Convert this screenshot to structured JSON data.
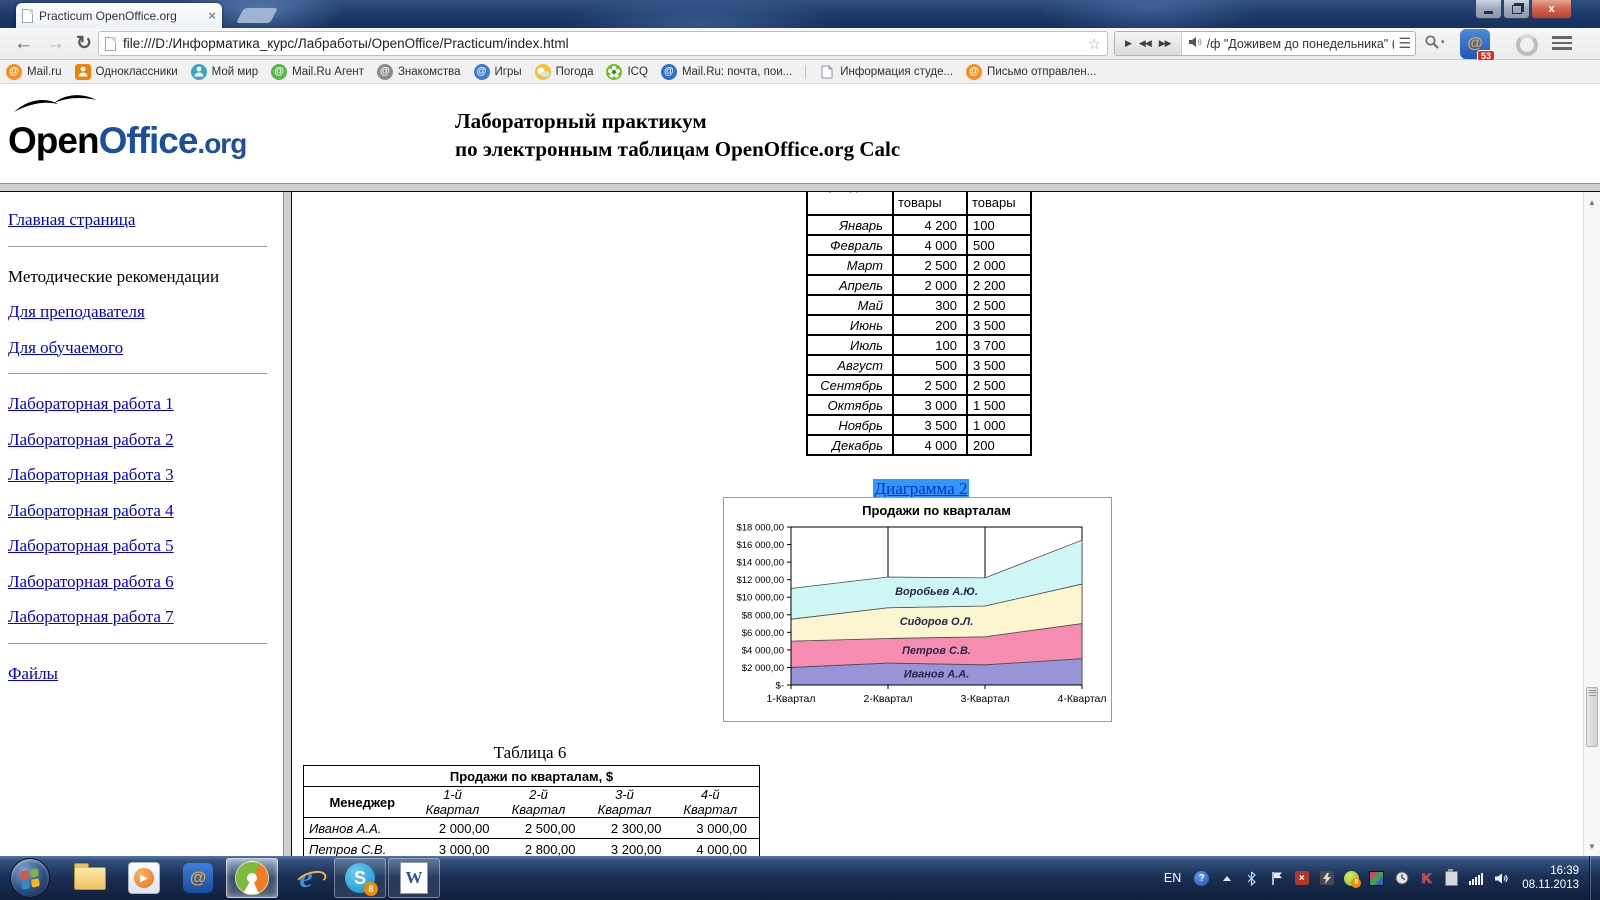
{
  "browser": {
    "tab_title": "Practicum OpenOffice.org",
    "tab_close": "×",
    "url": "file:///D:/Информатика_курс/Лабработы/OpenOffice/Practicum/index.html",
    "player_text": "/ф \"Доживем до понедельника\" (муз.К.Мол",
    "ext_badge": "53",
    "bookmarks": [
      {
        "label": "Mail.ru",
        "icon": "at",
        "color": "#f59123"
      },
      {
        "label": "Одноклассники",
        "icon": "person",
        "color": "#ee8208",
        "square": true
      },
      {
        "label": "Мой мир",
        "icon": "person",
        "color": "#3aa7c8"
      },
      {
        "label": "Mail.Ru Агент",
        "icon": "at",
        "color": "#58b847"
      },
      {
        "label": "Знакомства",
        "icon": "at",
        "color": "#8b8b8b"
      },
      {
        "label": "Игры",
        "icon": "at",
        "color": "#3f7ad1"
      },
      {
        "label": "Погода",
        "icon": "sun",
        "color": "#f5c32a"
      },
      {
        "label": "ICQ",
        "icon": "flower",
        "color": "#6fbf2a"
      },
      {
        "label": "Mail.Ru: почта, пои...",
        "icon": "at",
        "color": "#2f6fd0"
      },
      {
        "label": "Информация студе...",
        "icon": "page",
        "color": "#ffffff",
        "sep_before": true
      },
      {
        "label": "Письмо отправлен...",
        "icon": "at",
        "color": "#f59123"
      }
    ]
  },
  "header": {
    "logo": {
      "open": "Open",
      "office": "Office",
      "org": ".org"
    },
    "title_line1": "Лабораторный практикум",
    "title_line2": "по электронным таблицам OpenOffice.org Calc"
  },
  "sidebar": {
    "items": [
      {
        "type": "link",
        "label": "Главная страница"
      },
      {
        "type": "divider"
      },
      {
        "type": "text",
        "label": "Методические рекомендации"
      },
      {
        "type": "link",
        "label": "Для преподавателя"
      },
      {
        "type": "link",
        "label": "Для обучаемого"
      },
      {
        "type": "divider"
      },
      {
        "type": "link",
        "label": "Лабораторная работа 1"
      },
      {
        "type": "link",
        "label": "Лабораторная работа 2"
      },
      {
        "type": "link",
        "label": "Лабораторная работа 3"
      },
      {
        "type": "link",
        "label": "Лабораторная работа 4"
      },
      {
        "type": "link",
        "label": "Лабораторная работа 5"
      },
      {
        "type": "link",
        "label": "Лабораторная работа 6"
      },
      {
        "type": "link",
        "label": "Лабораторная работа 7"
      },
      {
        "type": "divider"
      },
      {
        "type": "link",
        "label": "Файлы"
      }
    ]
  },
  "content": {
    "monthly_table": {
      "headers": [
        "Период",
        "Зимние товары",
        "Летние товары"
      ],
      "rows": [
        [
          "Январь",
          "4 200",
          "100"
        ],
        [
          "Февраль",
          "4 000",
          "500"
        ],
        [
          "Март",
          "2 500",
          "2 000"
        ],
        [
          "Апрель",
          "2 000",
          "2 200"
        ],
        [
          "Май",
          "300",
          "2 500"
        ],
        [
          "Июнь",
          "200",
          "3 500"
        ],
        [
          "Июль",
          "100",
          "3 700"
        ],
        [
          "Август",
          "500",
          "3 500"
        ],
        [
          "Сентябрь",
          "2 500",
          "2 500"
        ],
        [
          "Октябрь",
          "3 000",
          "1 500"
        ],
        [
          "Ноябрь",
          "3 500",
          "1 000"
        ],
        [
          "Декабрь",
          "4 000",
          "200"
        ]
      ]
    },
    "diagram_caption": "Диаграмма 2",
    "table6": {
      "caption": "Таблица 6",
      "title": "Продажи по  кварталам, $",
      "columns": [
        "Менеджер",
        "1-й Квартал",
        "2-й Квартал",
        "3-й Квартал",
        "4-й Квартал"
      ],
      "rows": [
        [
          "Иванов А.А.",
          "2 000,00",
          "2 500,00",
          "2 300,00",
          "3 000,00"
        ],
        [
          "Петров С.В.",
          "3 000,00",
          "2 800,00",
          "3 200,00",
          "4 000,00"
        ]
      ]
    }
  },
  "chart_data": {
    "type": "area",
    "stacked": true,
    "title": "Продажи по кварталам",
    "categories": [
      "1-Квартал",
      "2-Квартал",
      "3-Квартал",
      "4-Квартал"
    ],
    "series": [
      {
        "name": "Иванов А.А.",
        "values": [
          2000,
          2500,
          2300,
          3000
        ],
        "color": "#9894d8"
      },
      {
        "name": "Петров С.В.",
        "values": [
          3000,
          2800,
          3200,
          4000
        ],
        "color": "#f78cb1"
      },
      {
        "name": "Сидоров О.Л.",
        "values": [
          2500,
          3500,
          3500,
          4500
        ],
        "color": "#fbf6d0"
      },
      {
        "name": "Воробьев А.Ю.",
        "values": [
          3500,
          3500,
          3200,
          5000
        ],
        "color": "#cef6f5"
      }
    ],
    "ylim": [
      0,
      18000
    ],
    "ytick_step": 2000,
    "ytick_labels": [
      "$-",
      "$2 000,00",
      "$4 000,00",
      "$6 000,00",
      "$8 000,00",
      "$10 000,00",
      "$12 000,00",
      "$14 000,00",
      "$16 000,00",
      "$18 000,00"
    ],
    "grid": "vertical-above-areas",
    "legend": "labels-inside-areas"
  },
  "taskbar": {
    "lang": "EN",
    "time": "16:39",
    "date": "08.11.2013",
    "apps": [
      {
        "name": "explorer"
      },
      {
        "name": "media-player"
      },
      {
        "name": "mailru-agent"
      },
      {
        "name": "amigo-browser",
        "active": true
      },
      {
        "name": "internet-explorer"
      },
      {
        "name": "skype",
        "running": true,
        "badge": "8"
      },
      {
        "name": "word",
        "running": true
      }
    ],
    "tray_icons": [
      "help",
      "expand",
      "bluetooth",
      "flag",
      "error",
      "flash",
      "icq",
      "cube",
      "scheduler",
      "kaspersky",
      "clipboard",
      "network",
      "volume"
    ]
  }
}
